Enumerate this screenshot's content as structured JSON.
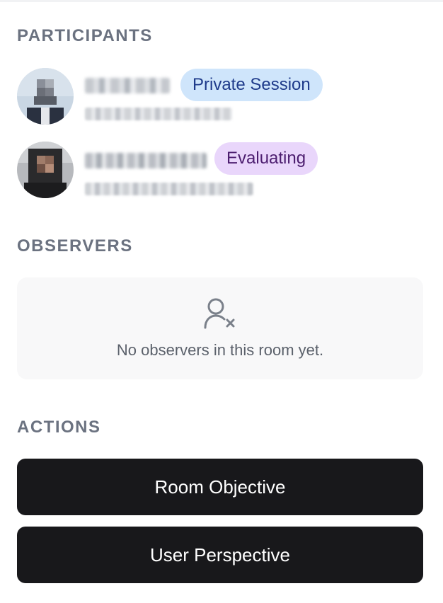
{
  "sections": {
    "participants_title": "PARTICIPANTS",
    "observers_title": "OBSERVERS",
    "actions_title": "ACTIONS"
  },
  "participants": [
    {
      "badge": "Private Session",
      "badge_color": "#cfe5fb"
    },
    {
      "badge": "Evaluating",
      "badge_color": "#e9d6fb"
    }
  ],
  "observers": {
    "empty_icon": "user-x-icon",
    "empty_text": "No observers in this room yet."
  },
  "actions": {
    "room_objective_label": "Room Objective",
    "user_perspective_label": "User Perspective"
  }
}
